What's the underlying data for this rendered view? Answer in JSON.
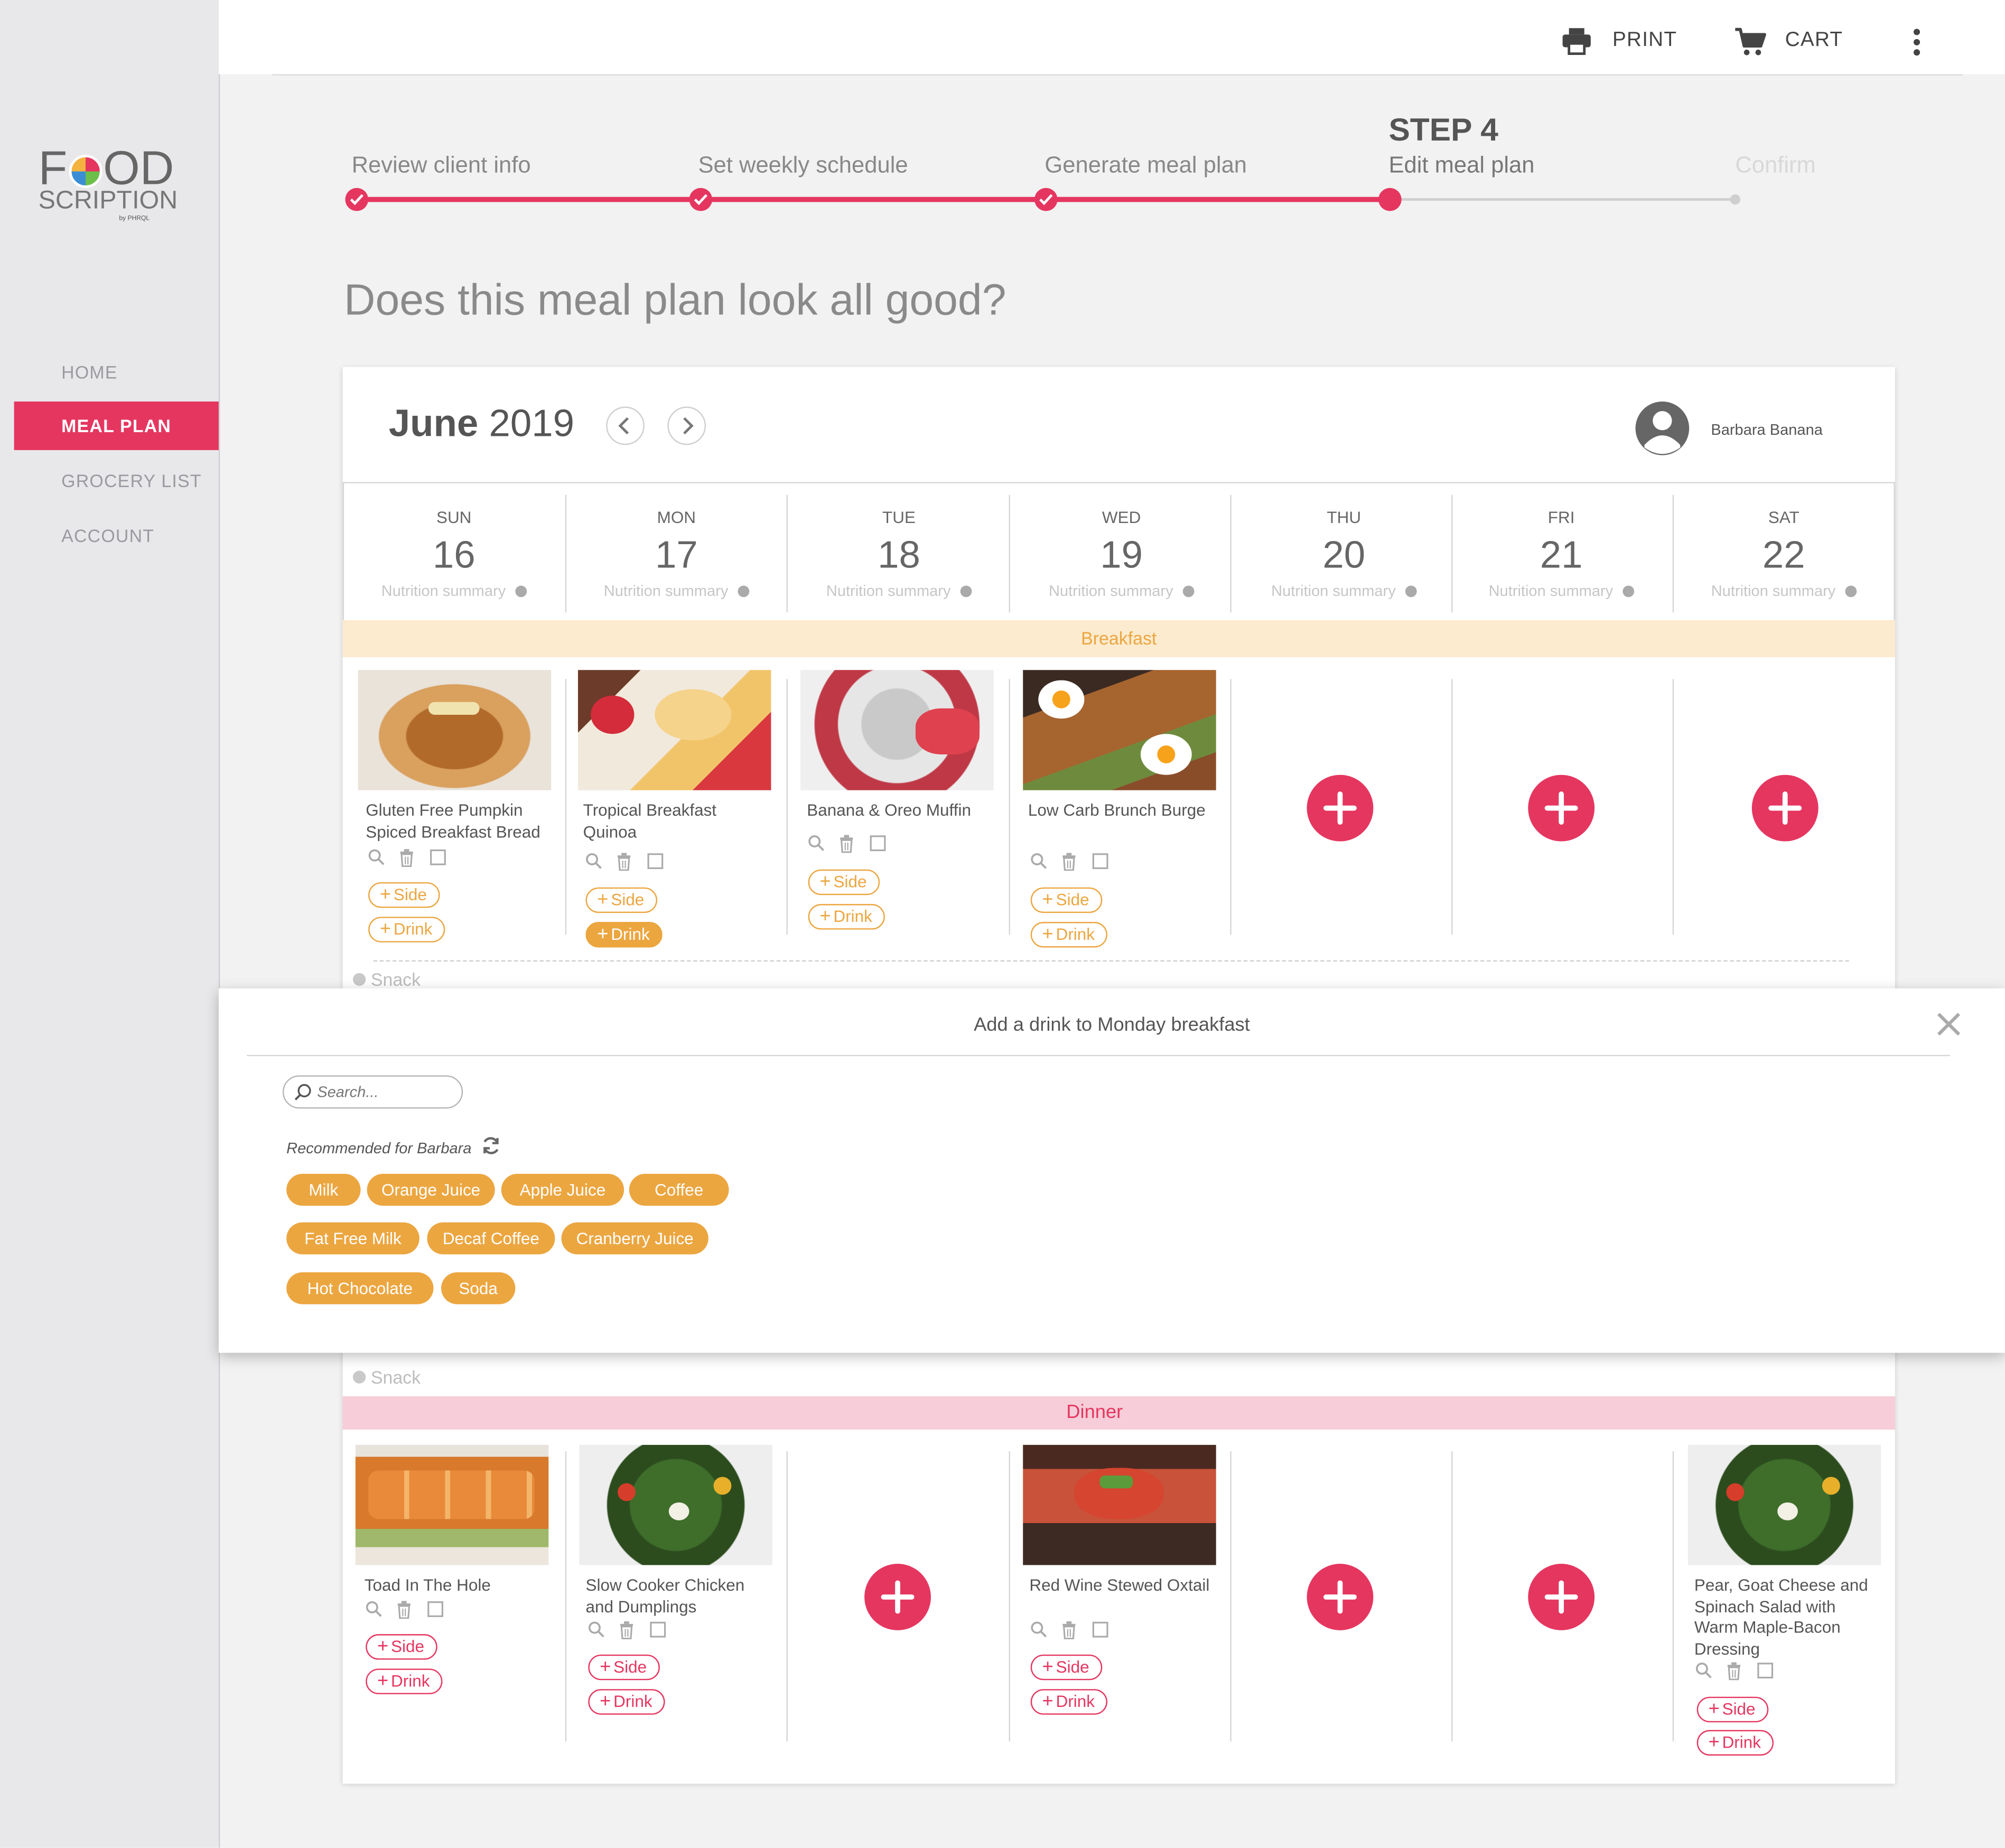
{
  "app": {
    "logo_line1": "FOOD",
    "logo_line2": "SCRIPTION",
    "logo_line3": "by PHRQL"
  },
  "sidebar": {
    "items": [
      {
        "label": "HOME",
        "active": false
      },
      {
        "label": "MEAL PLAN",
        "active": true
      },
      {
        "label": "GROCERY LIST",
        "active": false
      },
      {
        "label": "ACCOUNT",
        "active": false
      }
    ]
  },
  "topbar": {
    "print_label": "PRINT",
    "cart_label": "CART"
  },
  "stepper": {
    "current_step_label": "STEP 4",
    "steps": [
      {
        "label": "Review client info",
        "state": "done"
      },
      {
        "label": "Set weekly schedule",
        "state": "done"
      },
      {
        "label": "Generate meal plan",
        "state": "done"
      },
      {
        "label": "Edit meal plan",
        "state": "current"
      },
      {
        "label": "Confirm",
        "state": "pending"
      }
    ]
  },
  "page": {
    "heading": "Does this meal plan look all good?"
  },
  "calendar": {
    "month": "June",
    "year": "2019",
    "user_name": "Barbara Banana",
    "nutrition_label": "Nutrition summary",
    "days": [
      {
        "name": "SUN",
        "num": "16"
      },
      {
        "name": "MON",
        "num": "17"
      },
      {
        "name": "TUE",
        "num": "18"
      },
      {
        "name": "WED",
        "num": "19"
      },
      {
        "name": "THU",
        "num": "20"
      },
      {
        "name": "FRI",
        "num": "21"
      },
      {
        "name": "SAT",
        "num": "22"
      }
    ],
    "breakfast": {
      "label": "Breakfast",
      "meals": [
        {
          "title": "Gluten Free Pumpkin Spiced Breakfast Bread"
        },
        {
          "title": "Tropical Breakfast Quinoa"
        },
        {
          "title": "Banana & Oreo Muffin"
        },
        {
          "title": "Low Carb Brunch Burge"
        }
      ]
    },
    "snack_label": "Snack",
    "dinner": {
      "label": "Dinner",
      "meals": [
        {
          "title": "Toad In The Hole"
        },
        {
          "title": "Slow Cooker Chicken and Dumplings"
        },
        {
          "title": "Red Wine Stewed Oxtail"
        },
        {
          "title": "Pear, Goat Cheese and Spinach Salad with Warm Maple-Bacon Dressing"
        }
      ]
    },
    "side_label": "Side",
    "drink_label": "Drink"
  },
  "popup": {
    "title": "Add a drink to Monday breakfast",
    "search_placeholder": "Search...",
    "recommended_label": "Recommended for Barbara",
    "chips": [
      "Milk",
      "Orange Juice",
      "Apple Juice",
      "Coffee",
      "Fat Free Milk",
      "Decaf Coffee",
      "Cranberry Juice",
      "Hot Chocolate",
      "Soda"
    ]
  },
  "colors": {
    "accent": "#e53660",
    "breakfast_band": "#fcebcf",
    "breakfast_text": "#eca640",
    "dinner_band": "#f6cdd8",
    "dinner_text": "#e53660"
  }
}
